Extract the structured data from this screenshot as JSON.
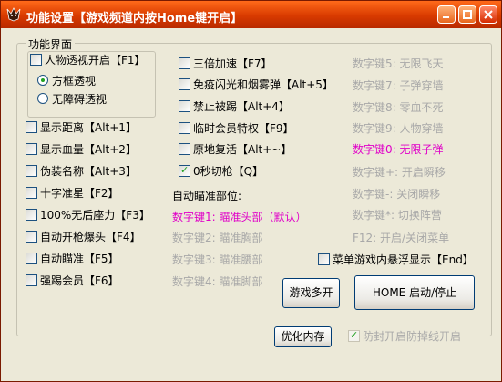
{
  "window": {
    "title": "功能设置【游戏频道内按Home键开启】"
  },
  "group": {
    "label": "功能界面",
    "sub": {
      "esp": "人物透视开启【F1】",
      "radio_box": "方框透视",
      "radio_clean": "无障碍透视"
    }
  },
  "left": [
    {
      "label": "显示距离【Alt+1】",
      "key": "Alt+1",
      "checked": false
    },
    {
      "label": "显示血量【Alt+2】",
      "checked": false
    },
    {
      "label": "伪装名称【Alt+3】",
      "checked": false
    },
    {
      "label": "十字准星【F2】",
      "checked": false
    },
    {
      "label": "100%无后座力【F3】",
      "checked": false
    },
    {
      "label": "自动开枪爆头【F4】",
      "checked": false
    },
    {
      "label": "自动瞄准【F5】",
      "checked": false
    },
    {
      "label": "强踢会员【F6】",
      "checked": false
    }
  ],
  "middle": [
    {
      "label": "三倍加速【F7】",
      "checked": false
    },
    {
      "label": "免疫闪光和烟雾弹【Alt+5】",
      "checked": false
    },
    {
      "label": "禁止被踢【Alt+4】",
      "checked": false
    },
    {
      "label": "临时会员特权【F9】",
      "checked": false
    },
    {
      "label": "原地复活【Alt+~】",
      "checked": false
    },
    {
      "label": "0秒切枪【Q】",
      "checked": true
    }
  ],
  "aim": {
    "title": "自动瞄准部位:",
    "options": [
      {
        "label": "数字键1: 瞄准头部（默认）",
        "active": true
      },
      {
        "label": "数字键2: 瞄准胸部",
        "active": false
      },
      {
        "label": "数字键3: 瞄准腰部",
        "active": false
      },
      {
        "label": "数字键4: 瞄准脚部",
        "active": false
      }
    ]
  },
  "right": [
    {
      "label": "数字键5: 无限飞天",
      "active": false
    },
    {
      "label": "数字键7: 子弹穿墙",
      "active": false
    },
    {
      "label": "数字键8: 零血不死",
      "active": false
    },
    {
      "label": "数字键9: 人物穿墙",
      "active": false
    },
    {
      "label": "数字键0: 无限子弹",
      "active": true
    },
    {
      "label": "数字键+: 开启瞬移",
      "active": false
    },
    {
      "label": "数字键-: 关闭瞬移",
      "active": false
    },
    {
      "label": "数字键*: 切换阵营",
      "active": false
    },
    {
      "label": "F12: 开启/关闭菜单",
      "active": false
    }
  ],
  "menu_float": {
    "label": "菜单游戏内悬浮显示【End】",
    "checked": false
  },
  "buttons": {
    "more_games": "游戏多开",
    "home_toggle": "HOME 启动/停止",
    "optimize_memory": "优化内存"
  },
  "anti_drop": {
    "label": "防封开启防掉线开启",
    "checked": true
  },
  "colors": {
    "title_bar": "#d83a00",
    "highlight": "#e000c8",
    "disabled_text": "#a8a8a8"
  }
}
